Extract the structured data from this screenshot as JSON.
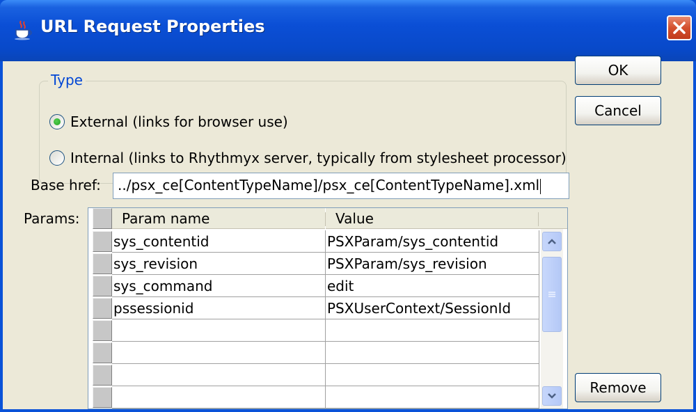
{
  "window": {
    "title": "URL Request Properties",
    "app_icon": "java-cup-icon",
    "close_icon": "close-icon"
  },
  "type_group": {
    "legend": "Type",
    "options": [
      {
        "label": "External (links for browser use)",
        "checked": true
      },
      {
        "label": "Internal (links to Rhythmyx server, typically from stylesheet processor)",
        "checked": false
      }
    ]
  },
  "buttons": {
    "ok": "OK",
    "cancel": "Cancel",
    "remove": "Remove"
  },
  "base_href": {
    "label": "Base href:",
    "value": "../psx_ce[ContentTypeName]/psx_ce[ContentTypeName].xml"
  },
  "params": {
    "label": "Params:",
    "columns": [
      "Param name",
      "Value"
    ],
    "rows": [
      {
        "name": "sys_contentid",
        "value": "PSXParam/sys_contentid"
      },
      {
        "name": "sys_revision",
        "value": "PSXParam/sys_revision"
      },
      {
        "name": "sys_command",
        "value": "edit"
      },
      {
        "name": "pssessionid",
        "value": "PSXUserContext/SessionId"
      },
      {
        "name": "",
        "value": ""
      },
      {
        "name": "",
        "value": ""
      },
      {
        "name": "",
        "value": ""
      },
      {
        "name": "",
        "value": ""
      }
    ]
  },
  "colors": {
    "titlebar": "#0a52d8",
    "dialog_bg": "#ece9d8",
    "close_button": "#d4502e",
    "legend_text": "#0046d5"
  }
}
